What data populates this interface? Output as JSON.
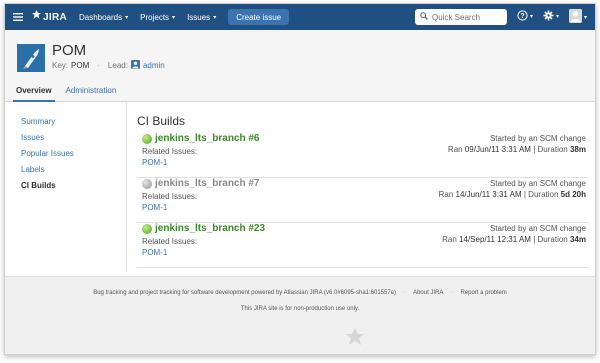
{
  "nav": {
    "logo_text": "JIRA",
    "items": [
      {
        "label": "Dashboards"
      },
      {
        "label": "Projects"
      },
      {
        "label": "Issues"
      }
    ],
    "create_label": "Create issue",
    "search_placeholder": "Quick Search",
    "brand_color": "#205081",
    "icons": [
      "menu-icon",
      "jira-logo-icon",
      "search-icon",
      "help-icon",
      "gear-icon",
      "user-icon"
    ]
  },
  "project": {
    "name": "POM",
    "key_label": "Key:",
    "key": "POM",
    "lead_label": "Lead:",
    "lead": "admin"
  },
  "tabs": [
    {
      "label": "Overview",
      "active": true
    },
    {
      "label": "Administration",
      "active": false
    }
  ],
  "sidebar": {
    "items": [
      {
        "label": "Summary",
        "active": false
      },
      {
        "label": "Issues",
        "active": false
      },
      {
        "label": "Popular Issues",
        "active": false
      },
      {
        "label": "Labels",
        "active": false
      },
      {
        "label": "CI Builds",
        "active": true
      }
    ]
  },
  "main": {
    "title": "CI Builds",
    "builds": [
      {
        "name": "jenkins_lts_branch #6",
        "status": "success",
        "related_label": "Related Issues:",
        "issue": "POM-1",
        "started": "Started by an SCM change",
        "ran_label": "Ran",
        "ran": "09/Jun/11 3:31 AM",
        "duration_label": "| Duration",
        "duration": "38m"
      },
      {
        "name": "jenkins_lts_branch #7",
        "status": "unknown",
        "related_label": "Related Issues:",
        "issue": "POM-1",
        "started": "Started by an SCM change",
        "ran_label": "Ran",
        "ran": "14/Jun/11 3:31 AM",
        "duration_label": "| Duration",
        "duration": "5d 20h"
      },
      {
        "name": "jenkins_lts_branch #23",
        "status": "success",
        "related_label": "Related Issues:",
        "issue": "POM-1",
        "started": "Started by an SCM change",
        "ran_label": "Ran",
        "ran": "14/Sep/11 12:31 AM",
        "duration_label": "| Duration",
        "duration": "34m"
      }
    ],
    "status_colors": {
      "success": "#7ac143",
      "unknown": "#b3b3b3"
    }
  },
  "footer": {
    "powered_text": "Bug tracking and project tracking for software development powered by Atlassian JIRA (v6.0#6095-sha1:601557e)",
    "about": "About JIRA",
    "report": "Report a problem",
    "notice": "This JIRA site is for non-production use only."
  }
}
